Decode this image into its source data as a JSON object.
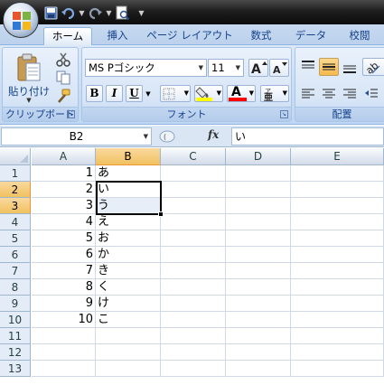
{
  "qat": {
    "icons": [
      "save-icon",
      "undo-icon",
      "redo-icon",
      "print-preview-icon"
    ]
  },
  "tabs": [
    "ホーム",
    "挿入",
    "ページ レイアウト",
    "数式",
    "データ",
    "校閲"
  ],
  "ribbon": {
    "clipboard": {
      "paste_label": "貼り付け",
      "group_label": "クリップボード"
    },
    "font": {
      "font_name": "MS Pゴシック",
      "font_size": "11",
      "bold": "B",
      "italic": "I",
      "underline": "U",
      "font_color_letter": "A",
      "group_label": "フォント",
      "fill_color": "#ffff00",
      "font_color": "#ff0000"
    },
    "alignment": {
      "group_label": "配置"
    }
  },
  "formula_bar": {
    "name_box": "B2",
    "fx": "fx",
    "content": "い"
  },
  "grid": {
    "columns": [
      "A",
      "B",
      "C",
      "D",
      "E"
    ],
    "selected_column": "B",
    "rows": [
      "1",
      "2",
      "3",
      "4",
      "5",
      "6",
      "7",
      "8",
      "9",
      "10",
      "11",
      "12",
      "13"
    ],
    "selected_rows": [
      "2",
      "3"
    ],
    "col_a": [
      "1",
      "2",
      "3",
      "4",
      "5",
      "6",
      "7",
      "8",
      "9",
      "10"
    ],
    "col_b": [
      "あ",
      "い",
      "う",
      "え",
      "お",
      "か",
      "き",
      "く",
      "け",
      "こ"
    ]
  }
}
